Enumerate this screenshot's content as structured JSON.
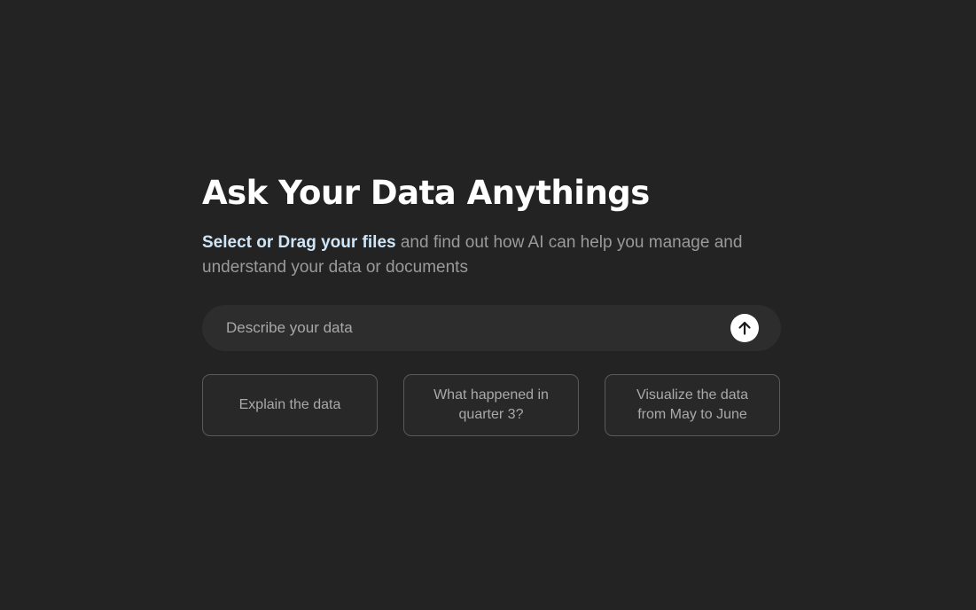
{
  "hero": {
    "title": "Ask Your Data Anythings",
    "subtitle_link": "Select or Drag your files",
    "subtitle_rest": " and find out how AI can help you manage and understand your data or documents"
  },
  "search": {
    "placeholder": "Describe your data",
    "value": "",
    "send_icon": "arrow-up-icon"
  },
  "suggestions": [
    {
      "label": "Explain the data"
    },
    {
      "label": "What happened in quarter 3?"
    },
    {
      "label": "Visualize the data from May to June"
    }
  ],
  "colors": {
    "background": "#232323",
    "input_background": "#2d2d2d",
    "link": "#cfe6f8",
    "muted_text": "#9a9a9a",
    "border": "#5a5a5a"
  }
}
